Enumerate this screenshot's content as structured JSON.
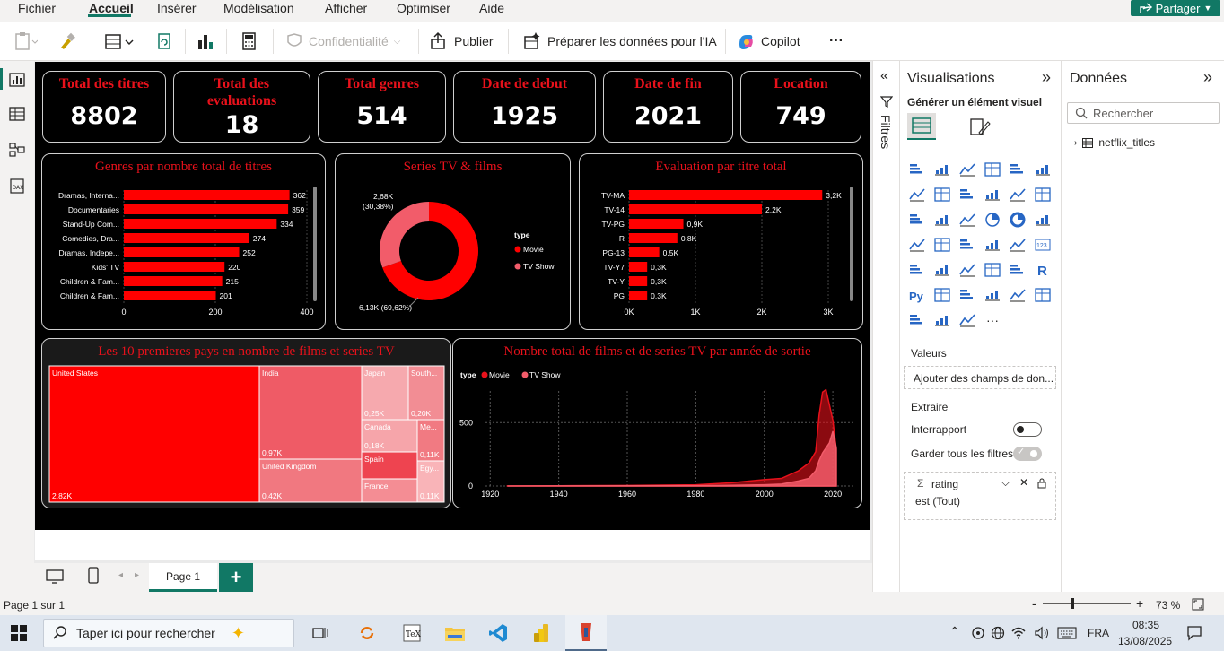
{
  "menu": {
    "items": [
      "Fichier",
      "Accueil",
      "Insérer",
      "Modélisation",
      "Afficher",
      "Optimiser",
      "Aide"
    ],
    "share_label": "Partager"
  },
  "ribbon": {
    "confidentiality": "Confidentialité",
    "publish": "Publier",
    "prepare": "Préparer les données pour l'IA",
    "copilot": "Copilot",
    "more": "···"
  },
  "kpis": [
    {
      "title": "Total des titres",
      "value": "8802"
    },
    {
      "title": "Total des evaluations",
      "value": "18"
    },
    {
      "title": "Total genres",
      "value": "514"
    },
    {
      "title": "Date de debut",
      "value": "1925"
    },
    {
      "title": "Date de fin",
      "value": "2021"
    },
    {
      "title": "Location",
      "value": "749"
    }
  ],
  "chart_data": [
    {
      "type": "bar",
      "title": "Genres par nombre total de titres",
      "categories": [
        "Dramas, Interna...",
        "Documentaries",
        "Stand-Up Com...",
        "Comedies, Dra...",
        "Dramas, Indepe...",
        "Kids' TV",
        "Children & Fam...",
        "Children & Fam..."
      ],
      "values": [
        362,
        359,
        334,
        274,
        252,
        220,
        215,
        201
      ],
      "data_labels": [
        "362",
        "359",
        "334",
        "274",
        "252",
        "220",
        "215",
        "201"
      ],
      "xticks": [
        "0",
        "200",
        "400"
      ],
      "xlim": [
        0,
        400
      ],
      "color": "#ff0000"
    },
    {
      "type": "pie",
      "title": "Series TV & films",
      "legend_title": "type",
      "series": [
        {
          "name": "Movie",
          "value": 6130,
          "label": "6,13K (69,62%)",
          "color": "#ff0000"
        },
        {
          "name": "TV Show",
          "value": 2680,
          "label": "2,68K\n(30,38%)",
          "color": "#f25c6a"
        }
      ]
    },
    {
      "type": "bar",
      "title": "Evaluation par titre total",
      "categories": [
        "TV-MA",
        "TV-14",
        "TV-PG",
        "R",
        "PG-13",
        "TV-Y7",
        "TV-Y",
        "PG"
      ],
      "values": [
        3200,
        2200,
        900,
        800,
        500,
        300,
        300,
        300
      ],
      "data_labels": [
        "3,2K",
        "2,2K",
        "0,9K",
        "0,8K",
        "0,5K",
        "0,3K",
        "0,3K",
        "0,3K"
      ],
      "xticks": [
        "0K",
        "1K",
        "2K",
        "3K"
      ],
      "xlim": [
        0,
        3300
      ],
      "color": "#ff0000"
    },
    {
      "type": "treemap",
      "title": "Les 10 premieres pays en nombre de films et series TV",
      "items": [
        {
          "name": "United States",
          "label": "2,82K",
          "color": "#ff0000"
        },
        {
          "name": "India",
          "label": "0,97K",
          "color": "#ef5b66"
        },
        {
          "name": "United Kingdom",
          "label": "0,42K",
          "color": "#f17880"
        },
        {
          "name": "Japan",
          "label": "0,25K",
          "color": "#f6a9ae"
        },
        {
          "name": "South...",
          "label": "0,20K",
          "color": "#f28d94"
        },
        {
          "name": "Canada",
          "label": "0,18K",
          "color": "#f6a5aa"
        },
        {
          "name": "Me...",
          "label": "0,11K",
          "color": "#f17a82"
        },
        {
          "name": "Spain",
          "label": "",
          "color": "#ee4450"
        },
        {
          "name": "France",
          "label": "",
          "color": "#f48d94"
        },
        {
          "name": "Egy...",
          "label": "0,11K",
          "color": "#f9b4b8"
        }
      ]
    },
    {
      "type": "area",
      "title": "Nombre total de films et de series TV par année de sortie",
      "legend_title": "type",
      "xticks": [
        1920,
        1940,
        1960,
        1980,
        2000,
        2020
      ],
      "yticks": [
        0,
        500
      ],
      "xlim": [
        1916,
        2026
      ],
      "ylim": [
        0,
        820
      ],
      "series": [
        {
          "name": "Movie",
          "color": "#e8111b",
          "x": [
            1925,
            1940,
            1960,
            1980,
            1990,
            2000,
            2005,
            2010,
            2013,
            2015,
            2016,
            2017,
            2018,
            2019,
            2020,
            2021
          ],
          "y": [
            1,
            2,
            4,
            10,
            25,
            50,
            60,
            120,
            180,
            270,
            560,
            740,
            760,
            640,
            520,
            290
          ]
        },
        {
          "name": "TV Show",
          "color": "#f25c6a",
          "x": [
            1925,
            1940,
            1960,
            1980,
            1990,
            2000,
            2005,
            2010,
            2013,
            2015,
            2016,
            2017,
            2018,
            2019,
            2020,
            2021
          ],
          "y": [
            0,
            1,
            2,
            3,
            5,
            10,
            15,
            40,
            60,
            120,
            200,
            260,
            300,
            340,
            430,
            300
          ]
        }
      ]
    }
  ],
  "filters_label": "Filtres",
  "viz_pane": {
    "title": "Visualisations",
    "subtitle": "Générer un élément visuel",
    "values_label": "Valeurs",
    "add_fields": "Ajouter des champs de don...",
    "drill_label": "Extraire",
    "cross_report": "Interrapport",
    "keep_filters": "Garder tous les filtres",
    "filter_field": "rating",
    "filter_value": "est (Tout)",
    "more": "···"
  },
  "data_pane": {
    "title": "Données",
    "search_placeholder": "Rechercher",
    "table": "netflix_titles"
  },
  "page_tab": "Page 1",
  "status": {
    "page_info": "Page 1 sur 1",
    "zoom": "73 %"
  },
  "taskbar": {
    "search_placeholder": "Taper ici pour rechercher",
    "lang": "FRA",
    "time": "08:35",
    "date": "13/08/2025"
  }
}
